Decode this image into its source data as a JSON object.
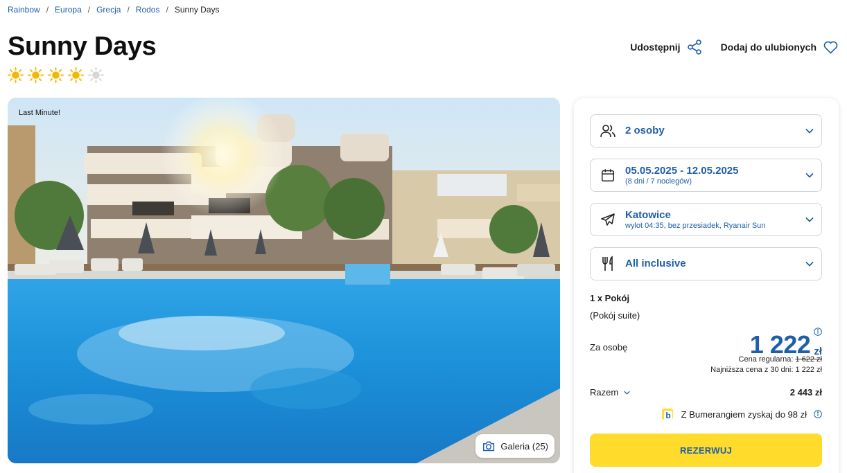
{
  "breadcrumb": [
    "Rainbow",
    "Europa",
    "Grecja",
    "Rodos",
    "Sunny Days"
  ],
  "breadcrumb_separator": "/",
  "hotel": {
    "name": "Sunny Days",
    "stars_filled": 4,
    "stars_total": 5
  },
  "actions": {
    "share": "Udostępnij",
    "favorite": "Dodaj do ulubionych"
  },
  "photo": {
    "tag": "Last Minute!",
    "gallery_label": "Galeria (25)"
  },
  "booking": {
    "persons": "2 osoby",
    "dates": "05.05.2025 - 12.05.2025",
    "dates_sub": "(8 dni / 7 noclegów)",
    "departure": "Katowice",
    "departure_sub": "wylot 04:35, bez przesiadek, Ryanair Sun",
    "board": "All inclusive",
    "room": "1 x Pokój",
    "room_type": "(Pokój suite)",
    "per_person_label": "Za osobę",
    "price": "1 222",
    "currency": "zł",
    "regular_label": "Cena regularna:",
    "regular_price": "1 622 zł",
    "lowest_30": "Najniższa cena z 30 dni: 1 222 zł",
    "total_label": "Razem",
    "total_value": "2 443 zł",
    "bumerang": "Z Bumerangiem zyskaj do 98 zł",
    "book_button": "REZERWUJ"
  },
  "colors": {
    "accent": "#1f5fa8",
    "button": "#ffdb2c",
    "star": "#f5b800"
  },
  "icons": [
    "share-icon",
    "heart-icon",
    "camera-icon",
    "people-icon",
    "calendar-icon",
    "plane-icon",
    "cutlery-icon",
    "chevron-down-icon",
    "info-icon",
    "bumerang-icon"
  ]
}
